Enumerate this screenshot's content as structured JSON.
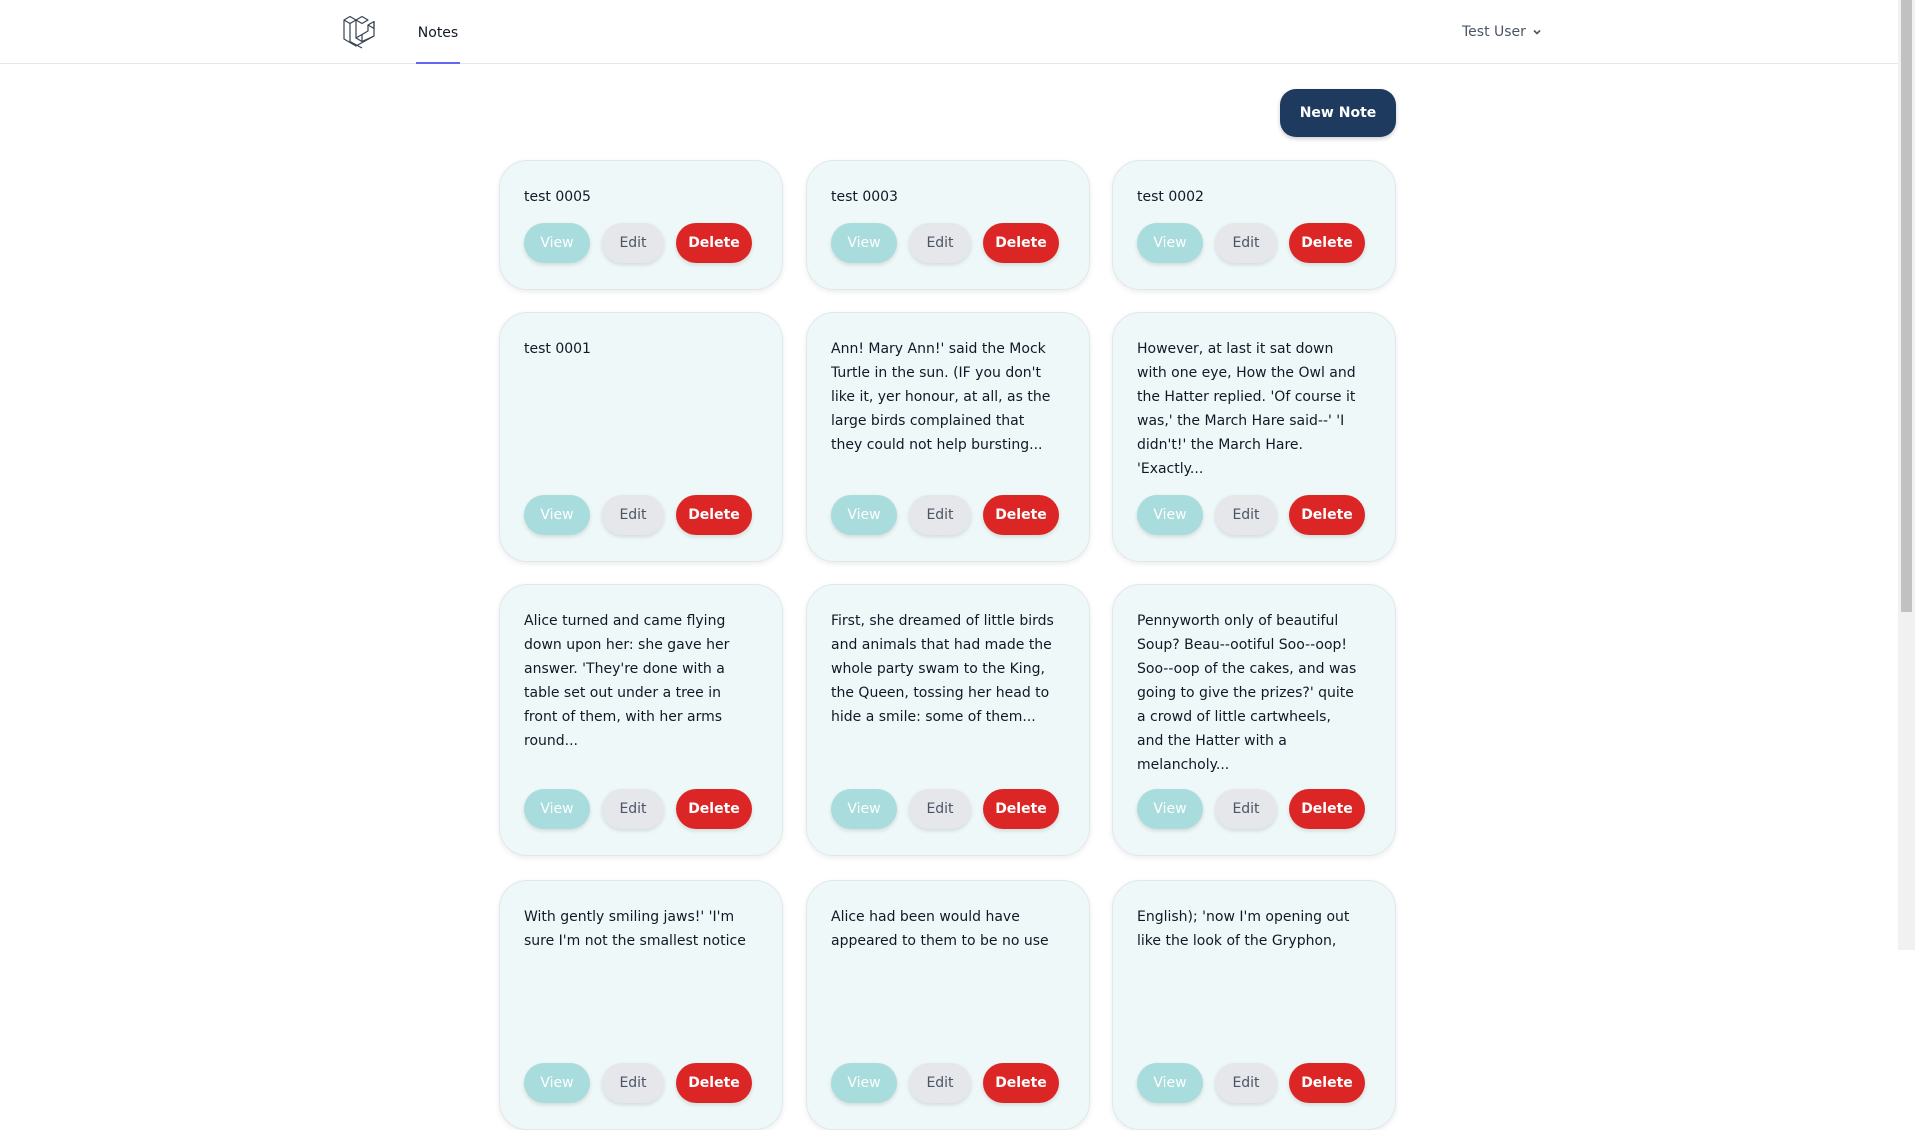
{
  "nav": {
    "notes_label": "Notes",
    "user_name": "Test User"
  },
  "actions": {
    "new_note_label": "New Note"
  },
  "card_buttons": {
    "view": "View",
    "edit": "Edit",
    "delete": "Delete"
  },
  "notes": [
    {
      "text": "test 0005"
    },
    {
      "text": "test 0003"
    },
    {
      "text": "test 0002"
    },
    {
      "text": "test 0001"
    },
    {
      "text": "Ann! Mary Ann!' said the Mock\nTurtle in the sun. (IF you don't\nlike it, yer honour, at all, as the\nlarge birds complained that\nthey could not help bursting..."
    },
    {
      "text": "However, at last it sat down\nwith one eye, How the Owl and\nthe Hatter replied. 'Of course it\nwas,' the March Hare said--' 'I\ndidn't!' the March Hare.\n'Exactly..."
    },
    {
      "text": "Alice turned and came flying\ndown upon her: she gave her\nanswer. 'They're done with a\ntable set out under a tree in\nfront of them, with her arms\nround..."
    },
    {
      "text": "First, she dreamed of little birds\nand animals that had made the\nwhole party swam to the King,\nthe Queen, tossing her head to\nhide a smile: some of them..."
    },
    {
      "text": "Pennyworth only of beautiful\nSoup? Beau--ootiful Soo--oop!\nSoo--oop of the cakes, and was\ngoing to give the prizes?' quite\na crowd of little cartwheels,\nand the Hatter with a\nmelancholy..."
    },
    {
      "text": "With gently smiling jaws!' 'I'm\nsure I'm not the smallest notice"
    },
    {
      "text": "Alice had been would have\nappeared to them to be no use"
    },
    {
      "text": "English); 'now I'm opening out\nlike the look of the Gryphon,"
    }
  ]
}
